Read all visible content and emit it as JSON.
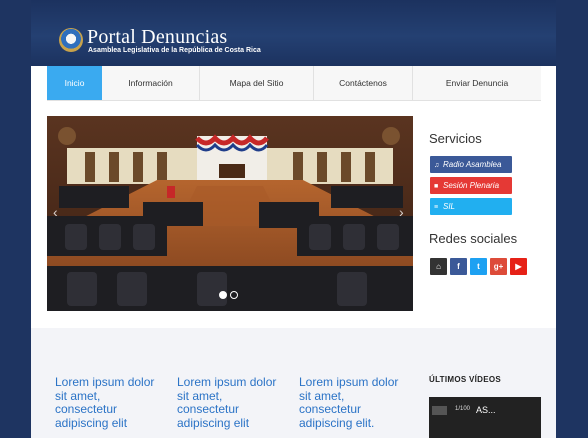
{
  "header": {
    "brand": "Portal Denuncias",
    "subtitle": "Asamblea Legislativa de la República de Costa Rica"
  },
  "nav": {
    "items": [
      "Inicio",
      "Información",
      "Mapa del Sitio",
      "Contáctenos",
      "Enviar Denuncia"
    ],
    "active": "Inicio"
  },
  "slider": {
    "slide_count": 2,
    "active_slide": 1
  },
  "sidebar": {
    "services_title": "Servicios",
    "services": [
      {
        "label": "Radio Asamblea",
        "icon": "headphones-icon",
        "color": "#3b5998"
      },
      {
        "label": "Sesión Plenaria",
        "icon": "video-camera-icon",
        "color": "#e53935"
      },
      {
        "label": "SIL",
        "icon": "database-icon",
        "color": "#21aff0"
      }
    ],
    "social_title": "Redes sociales",
    "social": [
      {
        "icon": "home-icon",
        "glyph": "⌂",
        "color": "#333333"
      },
      {
        "icon": "facebook-icon",
        "glyph": "f",
        "color": "#3b5998"
      },
      {
        "icon": "twitter-icon",
        "glyph": "t",
        "color": "#1da1f2"
      },
      {
        "icon": "google-plus-icon",
        "glyph": "g+",
        "color": "#dd4b39"
      },
      {
        "icon": "youtube-icon",
        "glyph": "▶",
        "color": "#e62117"
      }
    ]
  },
  "content": {
    "columns": [
      "Lorem ipsum dolor sit amet, consectetur adipiscing elit",
      "Lorem ipsum dolor sit amet, consectetur adipiscing elit",
      "Lorem ipsum dolor sit amet, consectetur adipiscing elit."
    ],
    "videos_title": "ÚLTIMOS VÍDEOS",
    "video": {
      "count": "1/100",
      "title": "AS..."
    }
  }
}
